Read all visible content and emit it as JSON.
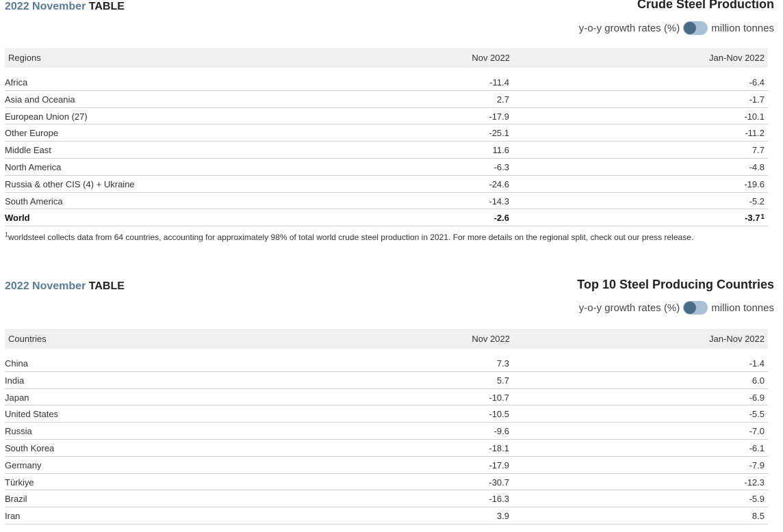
{
  "regions_section": {
    "heading_year": "2022",
    "heading_month": "November",
    "heading_table": "TABLE",
    "title": "Crude Steel Production",
    "toggle_left": "y-o-y growth rates (%)",
    "toggle_right": "million tonnes",
    "columns": [
      "Regions",
      "Nov 2022",
      "Jan-Nov 2022"
    ],
    "rows": [
      {
        "name": "Africa",
        "nov": "-11.4",
        "jan_nov": "-6.4"
      },
      {
        "name": "Asia and Oceania",
        "nov": "2.7",
        "jan_nov": "-1.7"
      },
      {
        "name": "European Union (27)",
        "nov": "-17.9",
        "jan_nov": "-10.1"
      },
      {
        "name": "Other Europe",
        "nov": "-25.1",
        "jan_nov": "-11.2"
      },
      {
        "name": "Middle East",
        "nov": "11.6",
        "jan_nov": "7.7"
      },
      {
        "name": "North America",
        "nov": "-6.3",
        "jan_nov": "-4.8"
      },
      {
        "name": "Russia & other CIS (4) + Ukraine",
        "nov": "-24.6",
        "jan_nov": "-19.6"
      },
      {
        "name": "South America",
        "nov": "-14.3",
        "jan_nov": "-5.2"
      }
    ],
    "total": {
      "name": "World",
      "nov": "-2.6",
      "jan_nov": "-3.7",
      "footnote_mark": "1"
    },
    "footnote_mark": "1",
    "footnote": "worldsteel collects data from 64 countries, accounting for approximately 98% of total world crude steel production in 2021. For more details on the regional split, check out our press release."
  },
  "countries_section": {
    "heading_year": "2022",
    "heading_month": "November",
    "heading_table": "TABLE",
    "title": "Top 10 Steel Producing Countries",
    "toggle_left": "y-o-y growth rates (%)",
    "toggle_right": "million tonnes",
    "columns": [
      "Countries",
      "Nov 2022",
      "Jan-Nov 2022"
    ],
    "rows": [
      {
        "name": "China",
        "nov": "7.3",
        "jan_nov": "-1.4"
      },
      {
        "name": "India",
        "nov": "5.7",
        "jan_nov": "6.0"
      },
      {
        "name": "Japan",
        "nov": "-10.7",
        "jan_nov": "-6.9"
      },
      {
        "name": "United States",
        "nov": "-10.5",
        "jan_nov": "-5.5"
      },
      {
        "name": "Russia",
        "nov": "-9.6",
        "jan_nov": "-7.0"
      },
      {
        "name": "South Korea",
        "nov": "-18.1",
        "jan_nov": "-6.1"
      },
      {
        "name": "Germany",
        "nov": "-17.9",
        "jan_nov": "-7.9"
      },
      {
        "name": "Türkiye",
        "nov": "-30.7",
        "jan_nov": "-12.3"
      },
      {
        "name": "Brazil",
        "nov": "-16.3",
        "jan_nov": "-5.9"
      },
      {
        "name": "Iran",
        "nov": "3.9",
        "jan_nov": "8.5"
      }
    ]
  },
  "colors": {
    "accent": "#5b7a95",
    "toggle_track": "#a9c0d4",
    "toggle_knob": "#4a6b86",
    "header_bg": "#f0f0f0",
    "row_border": "#cfcfcf"
  }
}
